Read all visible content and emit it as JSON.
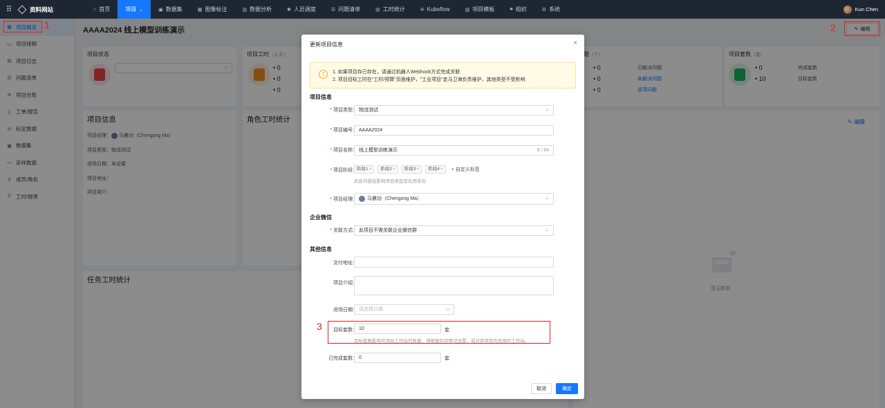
{
  "topbar": {
    "brand": "资料网站",
    "nav": [
      {
        "label": "首页",
        "icon": "home-icon"
      },
      {
        "label": "项目",
        "icon": "",
        "active": true
      },
      {
        "label": "数据集",
        "icon": "image-icon"
      },
      {
        "label": "图像标注",
        "icon": "annotate-icon"
      },
      {
        "label": "数据分析",
        "icon": "chart-icon"
      },
      {
        "label": "人员调度",
        "icon": "people-icon"
      },
      {
        "label": "问题清单",
        "icon": "list-icon"
      },
      {
        "label": "工时统计",
        "icon": "time-icon"
      },
      {
        "label": "Kubeflow",
        "icon": "flow-icon"
      },
      {
        "label": "项目模板",
        "icon": "template-icon"
      },
      {
        "label": "组织",
        "icon": "org-icon"
      },
      {
        "label": "系统",
        "icon": "gear-icon"
      }
    ],
    "user": "Kun Chen"
  },
  "sidebar": {
    "items": [
      {
        "label": "项目概览",
        "active": true
      },
      {
        "label": "项目排期"
      },
      {
        "label": "项目日志"
      },
      {
        "label": "问题清单"
      },
      {
        "label": "项目台账"
      },
      {
        "label": "工单/报告"
      },
      {
        "label": "标定数据"
      },
      {
        "label": "数据集"
      },
      {
        "label": "采样数据"
      },
      {
        "label": "成员/角色"
      },
      {
        "label": "工时/报表"
      }
    ]
  },
  "page": {
    "title": "AAAA2024 线上模型训练演示",
    "edit_button": "编辑",
    "edit_link": "编辑"
  },
  "cards": {
    "status": {
      "title": "项目状态"
    },
    "hours": {
      "title": "项目工时",
      "unit": "（人天）",
      "values": [
        "0",
        "0",
        "0"
      ]
    },
    "issues": {
      "title": "题",
      "unit": "（个）",
      "values": [
        "0",
        "0",
        "0"
      ],
      "links": [
        "已解决问题",
        "未解决问题",
        "该项问题"
      ]
    },
    "sets": {
      "title": "项目套数",
      "unit": "（套）",
      "values": [
        "0",
        "10"
      ],
      "labels": [
        "完成套数",
        "目标套数"
      ]
    },
    "info": {
      "title": "项目信息",
      "manager_label": "项目经理：",
      "manager": "马晨功（Chengong Ma）",
      "type": "项目类型：物流测试",
      "date": "进场日期：未设置",
      "address": "项目地址：",
      "intro": "项目简介："
    },
    "role_hours": {
      "title": "角色工时统计"
    },
    "task_hours": {
      "title": "任务工时统计"
    },
    "empty": "暂无数据"
  },
  "modal": {
    "title": "更新项目信息",
    "alert": [
      "1. 如果项目存已存在，请通过机器人Webhook方式完成关联",
      "2. 项目目标工时在\"工时/预算\"页面维护，\"工业项目\"走马卫海负责维护，其他类型不受影响"
    ],
    "sections": {
      "info": "项目信息",
      "wechat": "企业微信",
      "other": "其他信息"
    },
    "fields": {
      "type": {
        "label": "项目类型:",
        "value": "物流测试"
      },
      "code": {
        "label": "项目编号:",
        "value": "AAAA2024"
      },
      "name": {
        "label": "项目名称:",
        "value": "线上模型训练演示",
        "count": "8 / 64"
      },
      "stage": {
        "label": "项目阶段:",
        "tags": [
          "阶段1",
          "阶段2",
          "阶段3",
          "阶段4"
        ],
        "add": "+ 自定义标签",
        "hint": "此处内容会影响项目类型变化而变化"
      },
      "manager": {
        "label": "项目经理:",
        "value": "马晨功（Chengong Ma）"
      },
      "wechat": {
        "label": "关联方式:",
        "value": "此项目不需关联企业微信群"
      },
      "address": {
        "label": "交付地址:",
        "value": ""
      },
      "intro": {
        "label": "项目介绍:",
        "value": ""
      },
      "date": {
        "label": "进场日期:",
        "placeholder": "请选择日期"
      },
      "target": {
        "label": "目标套数:",
        "value": "10",
        "unit": "套",
        "hint": "目标套数影响可添加工作站的数量，请根据实际情况设置，或对存项目内无用的工作站。"
      },
      "done": {
        "label": "已完成套数:",
        "value": "0",
        "unit": "套"
      }
    },
    "cancel": "取消",
    "ok": "确定"
  },
  "annotations": [
    "1",
    "2",
    "3"
  ]
}
